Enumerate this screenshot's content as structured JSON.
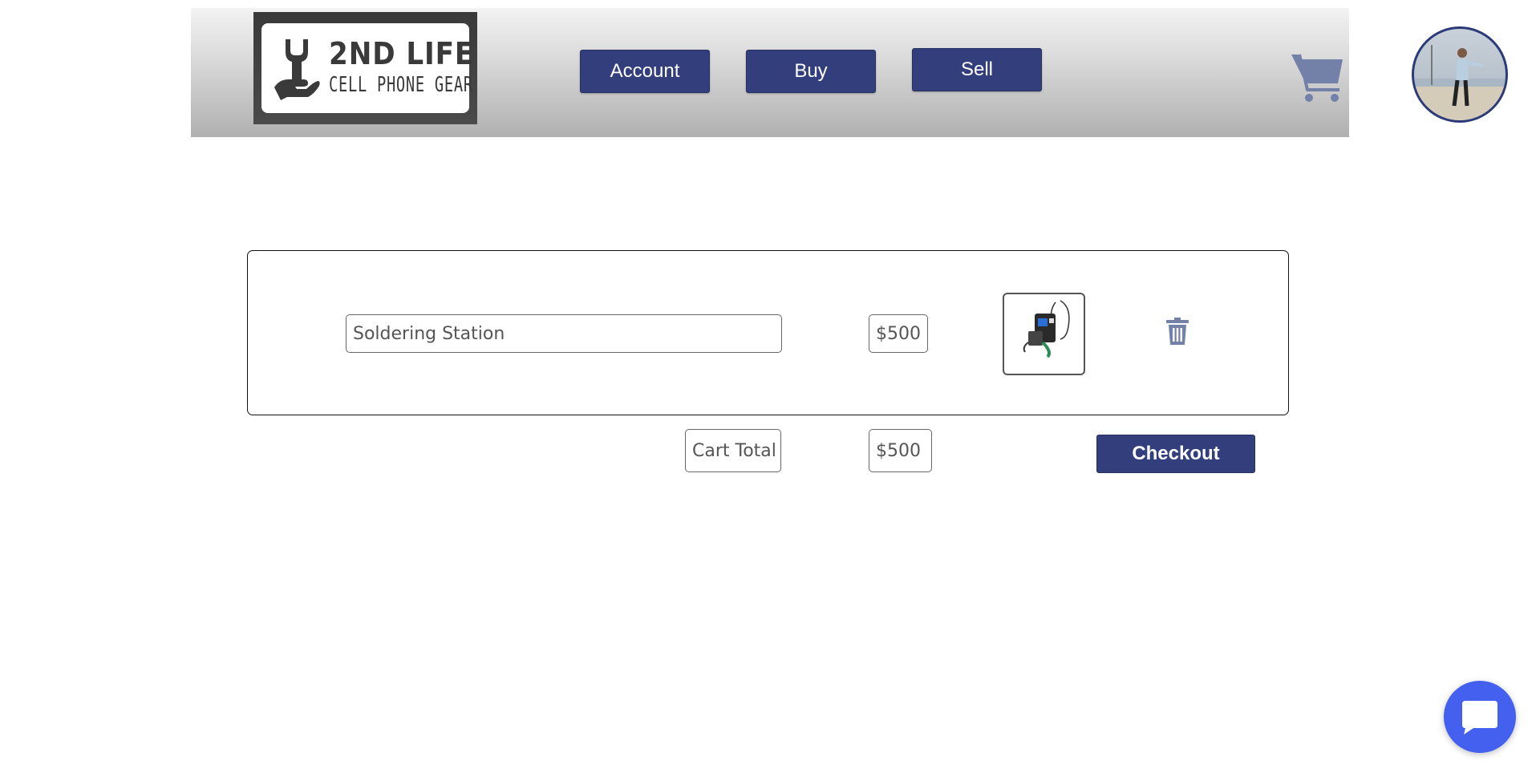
{
  "header": {
    "logo": {
      "title": "2ND LIFE",
      "subtitle": "CELL PHONE GEAR",
      "icon": "wrench-hand-icon"
    },
    "nav": {
      "account_label": "Account",
      "buy_label": "Buy",
      "sell_label": "Sell"
    },
    "cart_icon": "shopping-cart-icon",
    "avatar": "user-avatar"
  },
  "cart": {
    "items": [
      {
        "name": "Soldering Station",
        "price": "$500",
        "thumbnail": "soldering-station-image",
        "remove_icon": "trash-icon"
      }
    ],
    "total_label": "Cart Total",
    "total_value": "$500",
    "checkout_label": "Checkout"
  },
  "chat": {
    "icon": "chat-bubble-icon"
  },
  "colors": {
    "accent": "#323f7c",
    "chat": "#4361ee",
    "icon": "#7380a8"
  }
}
